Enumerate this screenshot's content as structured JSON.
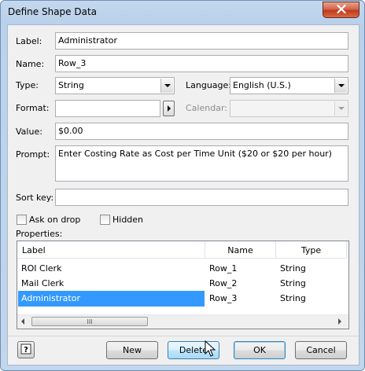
{
  "window": {
    "title": "Define Shape Data"
  },
  "form": {
    "label_caption": "Label:",
    "label_value": "Administrator",
    "name_caption": "Name:",
    "name_value": "Row_3",
    "type_caption": "Type:",
    "type_value": "String",
    "language_caption": "Language:",
    "language_value": "English (U.S.)",
    "format_caption": "Format:",
    "format_value": "",
    "calendar_caption": "Calendar:",
    "calendar_value": "",
    "value_caption": "Value:",
    "value_value": "$0.00",
    "prompt_caption": "Prompt:",
    "prompt_value": "Enter Costing Rate as Cost per Time Unit ($20 or $20 per hour)",
    "sortkey_caption": "Sort key:",
    "sortkey_value": "",
    "ask_on_drop_label": "Ask on drop",
    "ask_on_drop_checked": false,
    "hidden_label": "Hidden",
    "hidden_checked": false
  },
  "properties": {
    "caption": "Properties:",
    "columns": [
      "Label",
      "Name",
      "Type"
    ],
    "rows": [
      {
        "label": "ROI Clerk",
        "name": "Row_1",
        "type": "String"
      },
      {
        "label": "Mail Clerk",
        "name": "Row_2",
        "type": "String"
      },
      {
        "label": "Administrator",
        "name": "Row_3",
        "type": "String"
      }
    ],
    "selected_row": 2,
    "scroll_thumb_glyph": "III"
  },
  "buttons": {
    "help": "?",
    "new": "New",
    "delete": "Delete",
    "ok": "OK",
    "cancel": "Cancel"
  },
  "icons": {
    "close": "close-icon",
    "format-picker": "triangle-right-icon",
    "dropdown": "chevron-down-icon",
    "help": "help-icon",
    "cursor": "mouse-pointer-icon"
  },
  "colors": {
    "selection": "#3399ff",
    "close_button": "#c7432b",
    "title_gradient": "#c4d8ee"
  }
}
